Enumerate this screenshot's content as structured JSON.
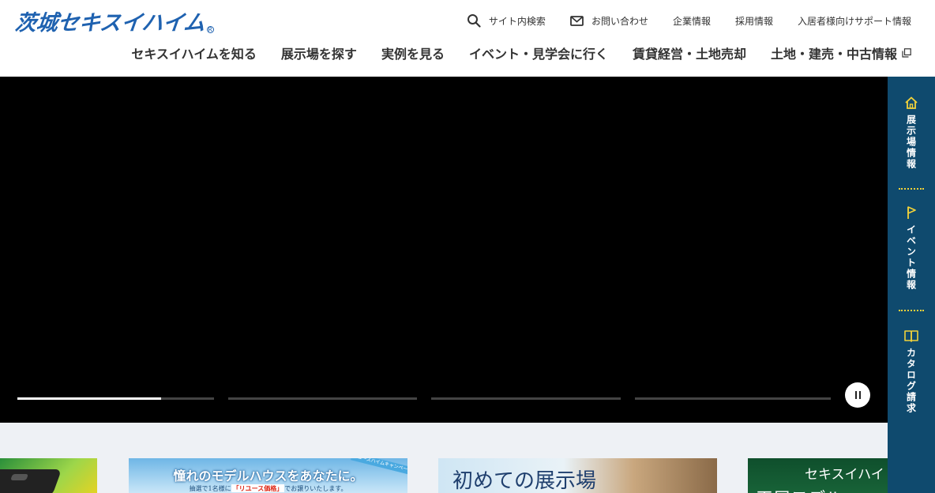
{
  "header": {
    "logo": "茨城セキスイハイム",
    "util_nav": [
      {
        "label": "サイト内検索",
        "icon": "search-icon"
      },
      {
        "label": "お問い合わせ",
        "icon": "mail-icon"
      },
      {
        "label": "企業情報"
      },
      {
        "label": "採用情報"
      },
      {
        "label": "入居者様向けサポート情報"
      }
    ],
    "main_nav": [
      {
        "label": "セキスイハイムを知る"
      },
      {
        "label": "展示場を探す"
      },
      {
        "label": "実例を見る"
      },
      {
        "label": "イベント・見学会に行く"
      },
      {
        "label": "賃貸経営・土地売却"
      },
      {
        "label": "土地・建売・中古情報",
        "icon": "external-link-icon"
      }
    ]
  },
  "hero": {
    "slides": [
      {
        "progress": 0.73
      },
      {
        "progress": 0
      },
      {
        "progress": 0
      },
      {
        "progress": 0
      }
    ],
    "pause_icon": "pause-icon"
  },
  "banners": [
    {
      "image": "hot-plate-banner"
    },
    {
      "title": "憧れのモデルハウスをあなたに。",
      "sub_before": "抽選で1名様に",
      "sub_highlight": "「リユース価格」",
      "sub_after": "でお譲りいたします。",
      "ribbon": "リユースハイムキャンペーン"
    },
    {
      "title": "初めての展示場"
    },
    {
      "title": "セキスイハイ",
      "sub": "平屋モデル"
    }
  ],
  "side_nav": [
    {
      "label": "展示場情報",
      "icon": "home-icon"
    },
    {
      "label": "イベント情報",
      "icon": "flag-icon"
    },
    {
      "label": "カタログ請求",
      "icon": "book-icon"
    }
  ],
  "colors": {
    "brand_blue": "#1f62b0",
    "side_bg": "#0f4a6e",
    "accent_yellow": "#f2d23a"
  }
}
